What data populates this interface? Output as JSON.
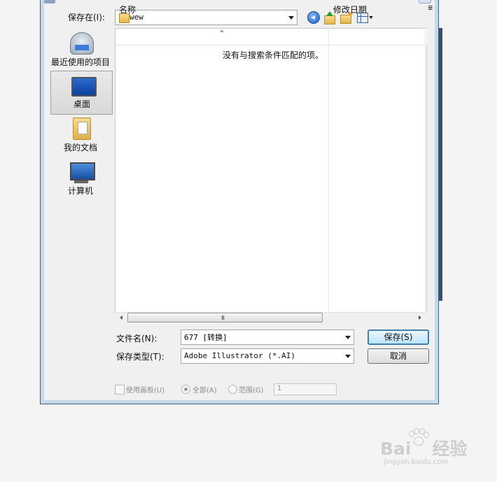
{
  "save_in": {
    "label": "保存在(I):",
    "value": "wew"
  },
  "places": [
    {
      "label": "最近使用的项目"
    },
    {
      "label": "桌面"
    },
    {
      "label": "我的文档"
    },
    {
      "label": "计算机"
    }
  ],
  "file_list": {
    "columns": [
      "名称",
      "修改日期",
      "≣"
    ],
    "empty_message": "没有与搜索条件匹配的项。"
  },
  "scrollbar": {
    "grip": "III"
  },
  "filename": {
    "label": "文件名(N):",
    "value": "677 [转换]"
  },
  "filetype": {
    "label": "保存类型(T):",
    "value": "Adobe Illustrator (*.AI)"
  },
  "buttons": {
    "save": "保存(S)",
    "cancel": "取消"
  },
  "options": {
    "use_artboards": "使用画板(U)",
    "all": "全部(A)",
    "range": "范围(G)",
    "range_value": "1"
  },
  "watermark": {
    "brand": "Bai",
    "suffix": "经验",
    "url": "jingyan.baidu.com"
  }
}
